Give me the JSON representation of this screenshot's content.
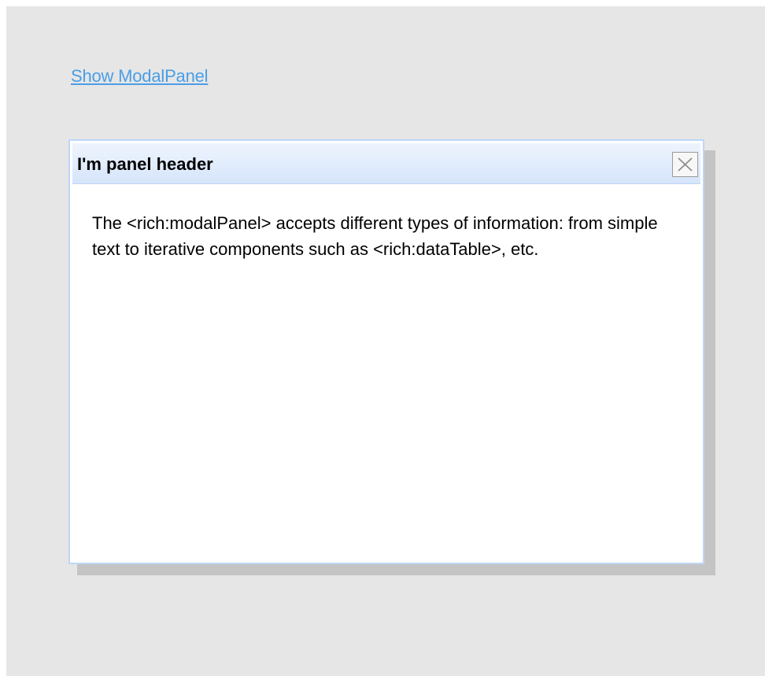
{
  "link": {
    "label": "Show ModalPanel"
  },
  "modal": {
    "header": "I'm panel header",
    "close_icon": "close-icon",
    "body_text": "The <rich:modalPanel> accepts different types of information: from simple text to iterative components such as <rich:dataTable>, etc."
  },
  "colors": {
    "page_bg": "#e6e6e6",
    "link": "#4a9ee6",
    "panel_border": "#bed6f8",
    "header_gradient_top": "#eef4fd",
    "header_gradient_bottom": "#d6e5fb"
  }
}
